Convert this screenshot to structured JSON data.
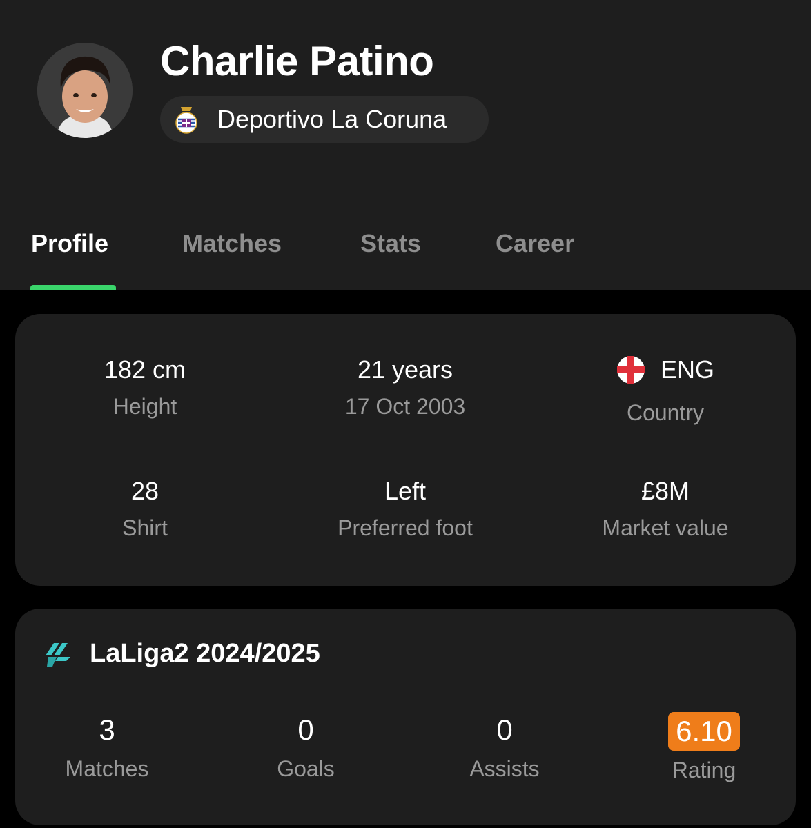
{
  "player": {
    "name": "Charlie Patino",
    "club": "Deportivo La Coruna"
  },
  "tabs": [
    {
      "label": "Profile",
      "active": true
    },
    {
      "label": "Matches",
      "active": false
    },
    {
      "label": "Stats",
      "active": false
    },
    {
      "label": "Career",
      "active": false
    }
  ],
  "profile": {
    "height": {
      "value": "182 cm",
      "label": "Height"
    },
    "age": {
      "value": "21 years",
      "label": "17 Oct 2003"
    },
    "country": {
      "value": "ENG",
      "label": "Country",
      "flag_icon": "england-flag-icon"
    },
    "shirt": {
      "value": "28",
      "label": "Shirt"
    },
    "foot": {
      "value": "Left",
      "label": "Preferred foot"
    },
    "market_value": {
      "value": "£8M",
      "label": "Market value"
    }
  },
  "season": {
    "title": "LaLiga2 2024/2025",
    "icon": "laliga-icon",
    "matches": {
      "value": "3",
      "label": "Matches"
    },
    "goals": {
      "value": "0",
      "label": "Goals"
    },
    "assists": {
      "value": "0",
      "label": "Assists"
    },
    "rating": {
      "value": "6.10",
      "label": "Rating"
    }
  },
  "colors": {
    "background": "#000000",
    "surface": "#1e1e1e",
    "accent_green": "#3ad56b",
    "rating_orange": "#ef7d1a",
    "muted_text": "#9a9a9a",
    "laliga_teal": "#3cc8c8"
  }
}
